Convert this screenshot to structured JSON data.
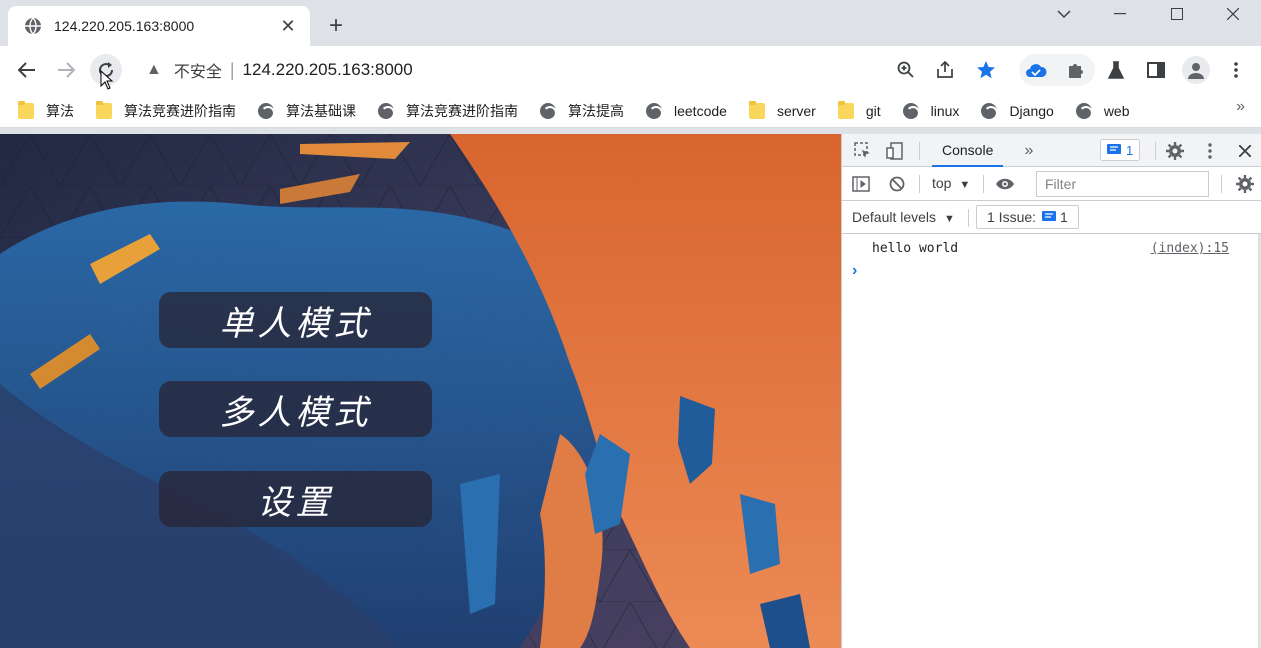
{
  "browser": {
    "tab": {
      "title": "124.220.205.163:8000"
    },
    "new_tab_symbol": "+",
    "window_controls": {
      "minimize": "⌄",
      "restore": "—",
      "maximize": "☐",
      "close": "✕"
    },
    "address": {
      "security_label": "不安全",
      "url": "124.220.205.163:8000",
      "warning_symbol": "▲"
    },
    "bookmarks": [
      {
        "label": "算法",
        "icon": "folder-icon"
      },
      {
        "label": "算法竞赛进阶指南",
        "icon": "folder-icon"
      },
      {
        "label": "算法基础课",
        "icon": "globe-icon"
      },
      {
        "label": "算法竞赛进阶指南",
        "icon": "globe-icon"
      },
      {
        "label": "算法提高",
        "icon": "globe-icon"
      },
      {
        "label": "leetcode",
        "icon": "globe-icon"
      },
      {
        "label": "server",
        "icon": "folder-icon"
      },
      {
        "label": "git",
        "icon": "folder-icon"
      },
      {
        "label": "linux",
        "icon": "globe-icon"
      },
      {
        "label": "Django",
        "icon": "globe-icon"
      },
      {
        "label": "web",
        "icon": "globe-icon"
      }
    ],
    "bookmarks_more": "»"
  },
  "page": {
    "menu": {
      "single_player": "单人模式",
      "multi_player": "多人模式",
      "settings": "设置"
    }
  },
  "devtools": {
    "active_tab": "Console",
    "more_tabs": "»",
    "issues_badge_count": "1",
    "context": "top",
    "filter_placeholder": "Filter",
    "levels": "Default levels",
    "issues_label": "1 Issue:",
    "issues_count": "1",
    "console": [
      {
        "message": "hello world",
        "source": "(index):15"
      }
    ],
    "prompt_symbol": "›"
  },
  "colors": {
    "accent_blue": "#1a73e8",
    "orange_art": "#e8874a",
    "blue_art": "#2a6fb0",
    "dark_bg": "#2b2f4a"
  }
}
